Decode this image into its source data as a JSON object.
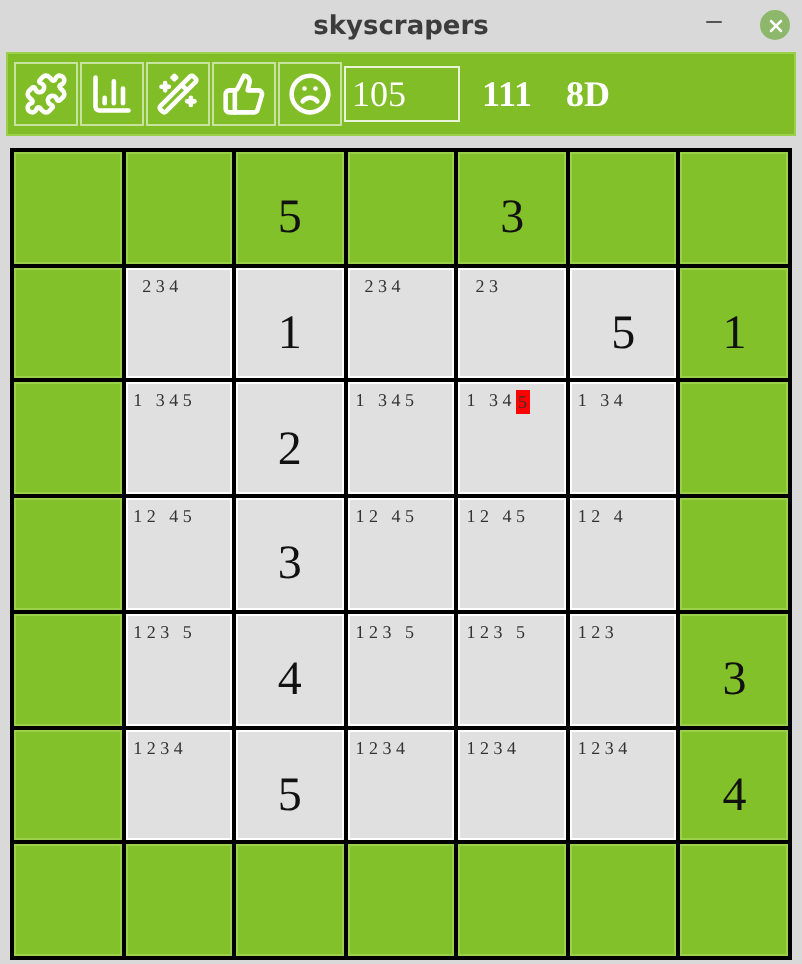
{
  "window": {
    "title": "skyscrapers"
  },
  "toolbar": {
    "tools": [
      {
        "kind": "puzzle"
      },
      {
        "kind": "chart"
      },
      {
        "kind": "wand"
      },
      {
        "kind": "thumbs"
      },
      {
        "kind": "sad"
      }
    ],
    "input": {
      "value": "105"
    },
    "texts": [
      "111",
      "8D"
    ]
  },
  "grid": [
    [
      {
        "kind": "clue"
      },
      {
        "kind": "clue"
      },
      {
        "kind": "clue",
        "value": "5"
      },
      {
        "kind": "clue"
      },
      {
        "kind": "clue",
        "value": "3"
      },
      {
        "kind": "clue"
      },
      {
        "kind": "clue"
      }
    ],
    [
      {
        "kind": "clue"
      },
      {
        "kind": "cell",
        "candidates": [
          {
            "text": "  2 3 4",
            "highlighted": false
          }
        ]
      },
      {
        "kind": "cell",
        "value": "1"
      },
      {
        "kind": "cell",
        "candidates": [
          {
            "text": "  2 3 4",
            "highlighted": false
          }
        ]
      },
      {
        "kind": "cell",
        "candidates": [
          {
            "text": "  2 3",
            "highlighted": false
          }
        ]
      },
      {
        "kind": "cell",
        "value": "5"
      },
      {
        "kind": "clue",
        "value": "1"
      }
    ],
    [
      {
        "kind": "clue"
      },
      {
        "kind": "cell",
        "candidates": [
          {
            "text": "1   3 4 5",
            "highlighted": false
          }
        ]
      },
      {
        "kind": "cell",
        "value": "2"
      },
      {
        "kind": "cell",
        "candidates": [
          {
            "text": "1   3 4 5",
            "highlighted": false
          }
        ]
      },
      {
        "kind": "cell",
        "candidates": [
          {
            "text": "1   3 4 ",
            "highlighted": false
          },
          {
            "text": "5",
            "highlighted": true
          }
        ]
      },
      {
        "kind": "cell",
        "candidates": [
          {
            "text": "1   3 4",
            "highlighted": false
          }
        ]
      },
      {
        "kind": "clue"
      }
    ],
    [
      {
        "kind": "clue"
      },
      {
        "kind": "cell",
        "candidates": [
          {
            "text": "1 2   4 5",
            "highlighted": false
          }
        ]
      },
      {
        "kind": "cell",
        "value": "3"
      },
      {
        "kind": "cell",
        "candidates": [
          {
            "text": "1 2   4 5",
            "highlighted": false
          }
        ]
      },
      {
        "kind": "cell",
        "candidates": [
          {
            "text": "1 2   4 5",
            "highlighted": false
          }
        ]
      },
      {
        "kind": "cell",
        "candidates": [
          {
            "text": "1 2   4",
            "highlighted": false
          }
        ]
      },
      {
        "kind": "clue"
      }
    ],
    [
      {
        "kind": "clue"
      },
      {
        "kind": "cell",
        "candidates": [
          {
            "text": "1 2 3   5",
            "highlighted": false
          }
        ]
      },
      {
        "kind": "cell",
        "value": "4"
      },
      {
        "kind": "cell",
        "candidates": [
          {
            "text": "1 2 3   5",
            "highlighted": false
          }
        ]
      },
      {
        "kind": "cell",
        "candidates": [
          {
            "text": "1 2 3   5",
            "highlighted": false
          }
        ]
      },
      {
        "kind": "cell",
        "candidates": [
          {
            "text": "1 2 3",
            "highlighted": false
          }
        ]
      },
      {
        "kind": "clue",
        "value": "3"
      }
    ],
    [
      {
        "kind": "clue"
      },
      {
        "kind": "cell",
        "candidates": [
          {
            "text": "1 2 3 4",
            "highlighted": false
          }
        ]
      },
      {
        "kind": "cell",
        "value": "5"
      },
      {
        "kind": "cell",
        "candidates": [
          {
            "text": "1 2 3 4",
            "highlighted": false
          }
        ]
      },
      {
        "kind": "cell",
        "candidates": [
          {
            "text": "1 2 3 4",
            "highlighted": false
          }
        ]
      },
      {
        "kind": "cell",
        "candidates": [
          {
            "text": "1 2 3 4",
            "highlighted": false
          }
        ]
      },
      {
        "kind": "clue",
        "value": "4"
      }
    ],
    [
      {
        "kind": "clue"
      },
      {
        "kind": "clue"
      },
      {
        "kind": "clue"
      },
      {
        "kind": "clue"
      },
      {
        "kind": "clue"
      },
      {
        "kind": "clue"
      },
      {
        "kind": "clue"
      }
    ]
  ]
}
